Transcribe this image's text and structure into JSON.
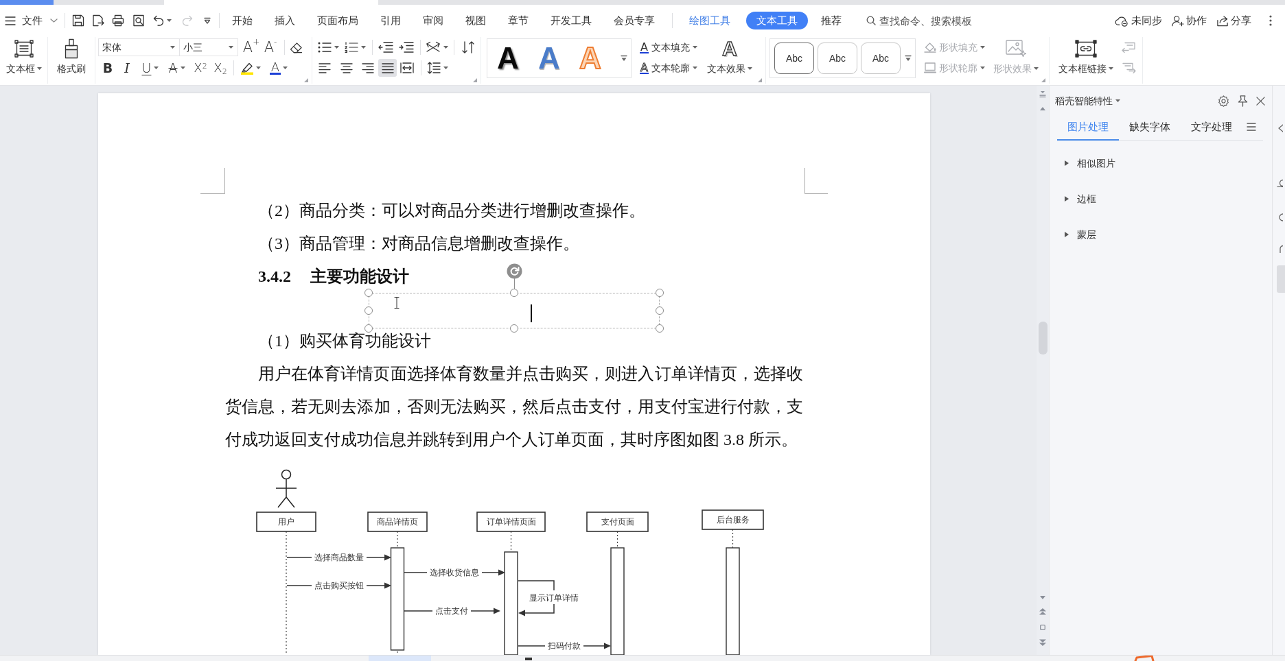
{
  "menu_bar": {
    "file_label": "文件",
    "redo_disabled": true,
    "tabs": [
      {
        "label": "开始",
        "kind": "main",
        "selected": false
      },
      {
        "label": "插入",
        "kind": "main",
        "selected": false
      },
      {
        "label": "页面布局",
        "kind": "main",
        "selected": false
      },
      {
        "label": "引用",
        "kind": "main",
        "selected": false
      },
      {
        "label": "审阅",
        "kind": "main",
        "selected": false
      },
      {
        "label": "视图",
        "kind": "main",
        "selected": false
      },
      {
        "label": "章节",
        "kind": "main",
        "selected": false
      },
      {
        "label": "开发工具",
        "kind": "main",
        "selected": false
      },
      {
        "label": "会员专享",
        "kind": "main",
        "selected": false
      },
      {
        "label": "绘图工具",
        "kind": "context",
        "selected": false
      },
      {
        "label": "文本工具",
        "kind": "context",
        "selected": true
      },
      {
        "label": "推荐",
        "kind": "main",
        "selected": false
      }
    ],
    "search": {
      "placeholder": "查找命令、搜索模板"
    },
    "actions": [
      {
        "label": "未同步"
      },
      {
        "label": "协作"
      },
      {
        "label": "分享"
      }
    ]
  },
  "ribbon": {
    "text_box": {
      "label": "文本框"
    },
    "format_painter": {
      "label": "格式刷"
    },
    "font": {
      "name": "宋体",
      "size": "小三",
      "grow": "A$^{+}$",
      "shrink": "A$^{-}$"
    },
    "format_buttons": [
      {
        "glyph": "B",
        "kind": "bold",
        "menu": false
      },
      {
        "glyph": "I",
        "kind": "italic",
        "menu": false
      },
      {
        "glyph": "U",
        "kind": "underline",
        "menu": true
      },
      {
        "glyph": "A",
        "kind": "strike",
        "menu": true
      },
      {
        "glyph": "X$^{2}$",
        "kind": "superscript",
        "menu": false
      },
      {
        "glyph": "X$_{2}$",
        "kind": "subscript",
        "menu": false
      }
    ],
    "font_color": {
      "glyph": "A"
    },
    "alignment": [
      {
        "selected": false
      },
      {
        "selected": false
      },
      {
        "selected": false
      },
      {
        "selected": true
      },
      {
        "selected": false
      }
    ],
    "art_styles": [
      {
        "glyph": "A",
        "kind": "shadow"
      },
      {
        "glyph": "A",
        "kind": "gradient"
      },
      {
        "glyph": "A",
        "kind": "outline"
      }
    ],
    "text_fill": {
      "glyph": "A",
      "label": "文本填充"
    },
    "text_outline": {
      "glyph": "A",
      "label": "文本轮廓"
    },
    "text_effect": {
      "glyph": "A",
      "label": "文本效果"
    },
    "shape_styles": [
      {
        "sample": "Abc",
        "selected": true
      },
      {
        "sample": "Abc",
        "selected": false
      },
      {
        "sample": "Abc",
        "selected": false
      }
    ],
    "shape_fill": {
      "label": "形状填充",
      "disabled": true
    },
    "shape_outline": {
      "label": "形状轮廓",
      "disabled": true
    },
    "shape_effect": {
      "label": "形状效果",
      "disabled": true
    },
    "text_box_link": {
      "label": "文本框链接"
    },
    "link_nav": [
      {
        "disabled": true
      },
      {
        "disabled": true
      }
    ]
  },
  "document": {
    "blocks": [
      {
        "kind": "item",
        "text": "（2）商品分类：可以对商品分类进行增删改查操作。"
      },
      {
        "kind": "item",
        "text": "（3）商品管理：对商品信息增删改查操作。"
      },
      {
        "kind": "heading",
        "number": "3.4.2",
        "text": "主要功能设计"
      },
      {
        "kind": "item",
        "text": "（1）购买体育功能设计"
      },
      {
        "kind": "body",
        "text": "用户在体育详情页面选择体育数量并点击购买，则进入订单详情页，选择收货信息，若无则去添加，否则无法购买，然后点击支付，用支付宝进行付款，支付成功返回支付成功信息并跳转到用户个人订单页面，其时序图如图 3.8 所示。"
      }
    ],
    "text_box": {
      "selected": true
    },
    "sequence_diagram": {
      "participants": [
        {
          "label": "用户",
          "kind": "actor"
        },
        {
          "label": "商品详情页",
          "kind": "object"
        },
        {
          "label": "订单详情页面",
          "kind": "object"
        },
        {
          "label": "支付页面",
          "kind": "object"
        },
        {
          "label": "后台服务",
          "kind": "object"
        }
      ],
      "messages": [
        {
          "label": "选择商品数量",
          "kind": "call"
        },
        {
          "label": "选择收货信息",
          "kind": "call"
        },
        {
          "label": "点击购买按钮",
          "kind": "call"
        },
        {
          "label": "显示订单详情",
          "kind": "self"
        },
        {
          "label": "点击支付",
          "kind": "call"
        },
        {
          "label": "扫码付款",
          "kind": "call"
        }
      ]
    }
  },
  "side_panel": {
    "title": "稻壳智能特性",
    "tabs": [
      {
        "label": "图片处理",
        "selected": true
      },
      {
        "label": "缺失字体",
        "selected": false
      },
      {
        "label": "文字处理",
        "selected": false
      }
    ],
    "sections": [
      {
        "label": "相似图片",
        "expanded": false
      },
      {
        "label": "边框",
        "expanded": false
      },
      {
        "label": "蒙层",
        "expanded": false
      }
    ]
  }
}
